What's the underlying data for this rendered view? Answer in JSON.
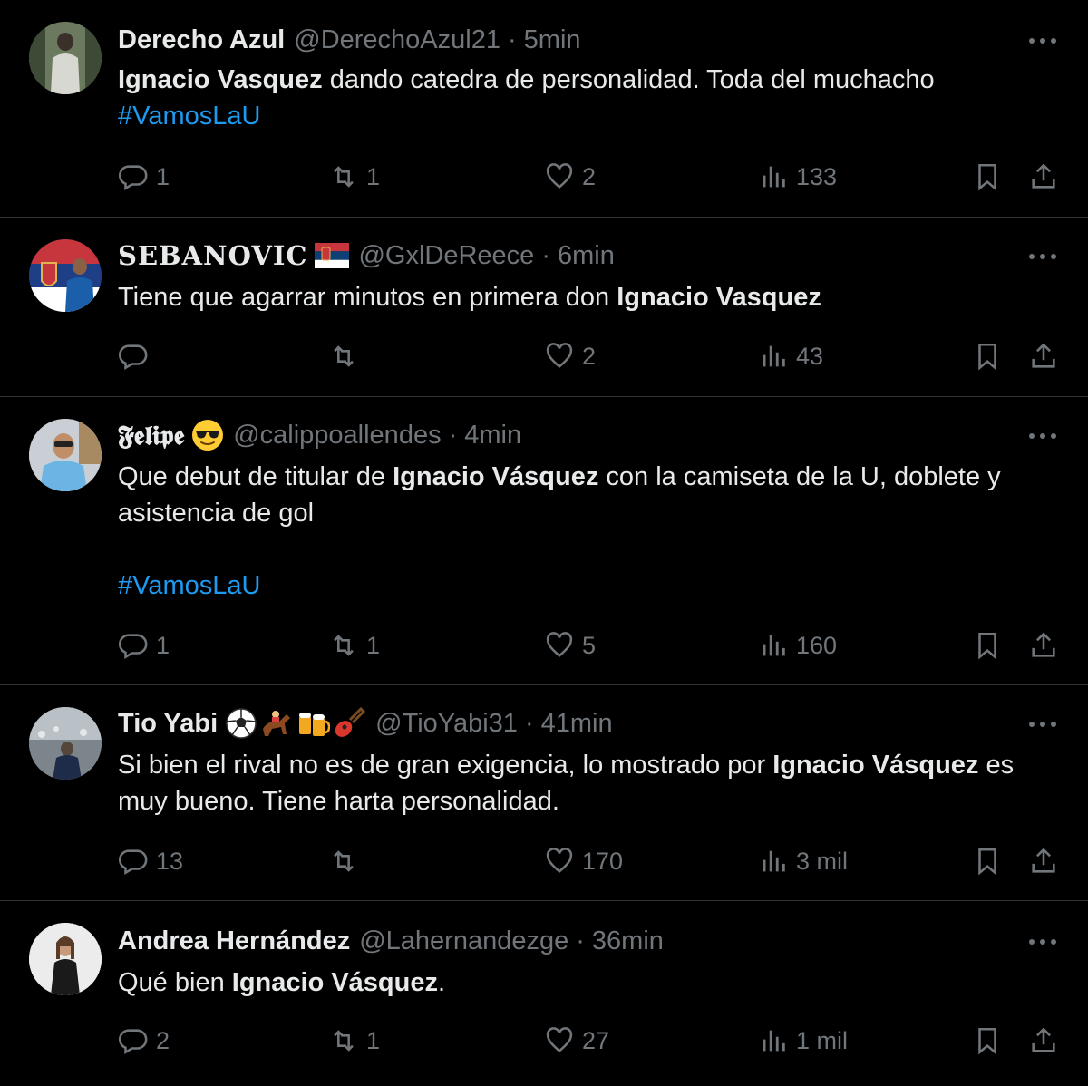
{
  "tweets": [
    {
      "name": "Derecho Azul",
      "name_emoji": [],
      "handle": "@DerechoAzul21",
      "time": "5min",
      "text_parts": [
        "Ignacio Vasquez",
        " dando catedra de personalidad. Toda del muchacho"
      ],
      "hashtag": "#VamosLaU",
      "replies": "1",
      "retweets": "1",
      "likes": "2",
      "views": "133"
    },
    {
      "name": "SEBANOVIC",
      "name_emoji": [
        "serbia-flag"
      ],
      "handle": "@GxlDeReece",
      "time": "6min",
      "text_parts": [
        "Tiene que agarrar minutos en primera don ",
        "Ignacio Vasquez"
      ],
      "replies": "",
      "retweets": "",
      "likes": "2",
      "views": "43"
    },
    {
      "name": "𝕱𝖊𝖑𝖎𝖕𝖊",
      "name_emoji": [
        "sunglasses-emoji"
      ],
      "handle": "@calippoallendes",
      "time": "4min",
      "text_parts": [
        "Que debut de titular de ",
        "Ignacio Vásquez",
        " con la camiseta de la U, doblete y asistencia de gol"
      ],
      "hashtag": "#VamosLaU",
      "replies": "1",
      "retweets": "1",
      "likes": "5",
      "views": "160"
    },
    {
      "name": "Tio Yabi",
      "name_emoji": [
        "soccer-ball",
        "horse-racing",
        "beer-mugs",
        "guitar"
      ],
      "handle": "@TioYabi31",
      "time": "41min",
      "text_parts": [
        "Si bien el rival no es de gran exigencia, lo mostrado por ",
        "Ignacio Vásquez",
        " es muy bueno. Tiene harta personalidad."
      ],
      "replies": "13",
      "retweets": "",
      "likes": "170",
      "views": "3 mil"
    },
    {
      "name": "Andrea Hernández",
      "name_emoji": [],
      "handle": "@Lahernandezge",
      "time": "36min",
      "text_parts": [
        "Qué bien ",
        "Ignacio Vásquez",
        "."
      ],
      "replies": "2",
      "retweets": "1",
      "likes": "27",
      "views": "1 mil"
    }
  ],
  "separator": "·",
  "colors": {
    "background": "#000000",
    "text": "#e7e9ea",
    "muted": "#71767b",
    "link": "#1d9bf0",
    "divider": "#2f3336"
  }
}
